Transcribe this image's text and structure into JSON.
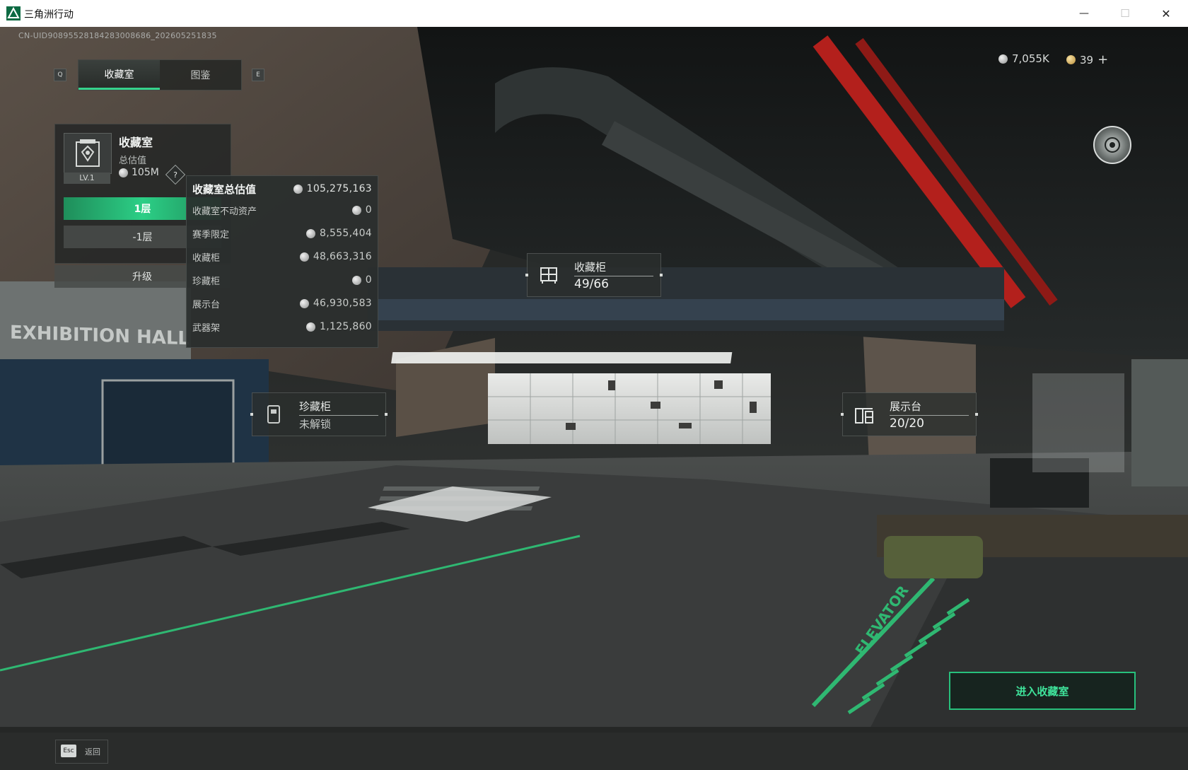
{
  "window": {
    "title": "三角洲行动",
    "minimize_glyph": "—",
    "maximize_glyph": "☐",
    "close_glyph": "✕"
  },
  "uid": "CN-UID9089552818428300868​6_202605251835",
  "tabs": {
    "prev_key": "Q",
    "next_key": "E",
    "items": [
      {
        "label": "收藏室",
        "active": true
      },
      {
        "label": "图鉴",
        "active": false
      }
    ]
  },
  "currency": {
    "silver": "7,055K",
    "gold": "39",
    "add_glyph": "+"
  },
  "room_card": {
    "title": "收藏室",
    "subtitle": "总估值",
    "value": "105M",
    "level": "LV.1",
    "help_glyph": "?",
    "floors": [
      "1层",
      "-1层"
    ],
    "upgrade_label": "升级"
  },
  "breakdown": {
    "header_label": "收藏室总估值",
    "header_value": "105,275,163",
    "rows": [
      {
        "label": "收藏室不动资产",
        "value": "0"
      },
      {
        "label": "赛季限定",
        "value": "8,555,404"
      },
      {
        "label": "收藏柜",
        "value": "48,663,316"
      },
      {
        "label": "珍藏柜",
        "value": "0"
      },
      {
        "label": "展示台",
        "value": "46,930,583"
      },
      {
        "label": "武器架",
        "value": "1,125,860"
      }
    ]
  },
  "hotspots": {
    "cabinet": {
      "title": "收藏柜",
      "value": "49/66",
      "icon": "cabinet-icon"
    },
    "rare_cabinet": {
      "title": "珍藏柜",
      "value": "未解锁",
      "icon": "rare-cabinet-icon"
    },
    "display_stand": {
      "title": "展示台",
      "value": "20/20",
      "icon": "display-stand-icon"
    }
  },
  "scene_text": {
    "wall_sign": "EXHIBITION HALL",
    "floor_marking": "ELEVATOR"
  },
  "enter_button": "进入收藏室",
  "footer": {
    "esc_key": "Esc",
    "back_label": "返回"
  },
  "colors": {
    "accent_green": "#2ccf86",
    "pipe_red": "#b3201c"
  }
}
